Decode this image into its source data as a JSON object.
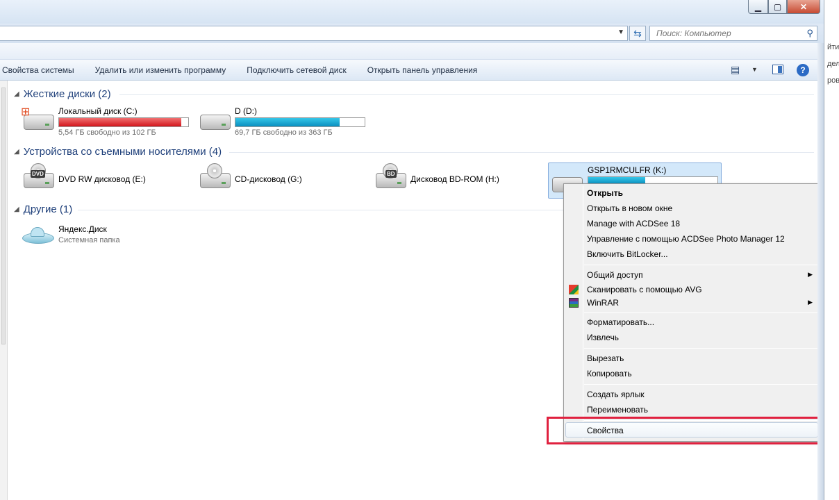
{
  "search": {
    "placeholder": "Поиск: Компьютер"
  },
  "toolbar": {
    "items": [
      "Свойства системы",
      "Удалить или изменить программу",
      "Подключить сетевой диск",
      "Открыть панель управления"
    ]
  },
  "groups": [
    {
      "title": "Жесткие диски (2)"
    },
    {
      "title": "Устройства со съемными носителями (4)"
    },
    {
      "title": "Другие (1)"
    }
  ],
  "drives": {
    "c": {
      "name": "Локальный диск (C:)",
      "free": "5,54 ГБ свободно из 102 ГБ",
      "used_fraction": 0.946
    },
    "d": {
      "name": "D (D:)",
      "free": "69,7 ГБ свободно из 363 ГБ",
      "used_fraction": 0.808
    },
    "e": {
      "name": "DVD RW дисковод (E:)",
      "badge": "DVD"
    },
    "g": {
      "name": "CD-дисковод (G:)"
    },
    "h": {
      "name": "Дисковод BD-ROM (H:)",
      "badge": "BD"
    },
    "k": {
      "name": "GSP1RMCULFR (K:)",
      "used_fraction": 0.44
    }
  },
  "other": {
    "name": "Яндекс.Диск",
    "subtitle": "Системная папка"
  },
  "context_menu": {
    "open": "Открыть",
    "open_new_window": "Открыть в новом окне",
    "acdsee18": "Manage with ACDSee 18",
    "acdsee_pm": "Управление с помощью ACDSee Photo Manager 12",
    "bitlocker": "Включить BitLocker...",
    "sharing": "Общий доступ",
    "avg": "Сканировать с помощью AVG",
    "winrar": "WinRAR",
    "format": "Форматировать...",
    "eject": "Извлечь",
    "cut": "Вырезать",
    "copy": "Копировать",
    "shortcut": "Создать ярлык",
    "rename": "Переименовать",
    "properties": "Свойства"
  },
  "right_frame": [
    "йти",
    "",
    "дели",
    "ров"
  ],
  "colors": {
    "highlight_box": "#e0213f",
    "group_title": "#1e3f7a",
    "selection": "#d3e8fa"
  }
}
